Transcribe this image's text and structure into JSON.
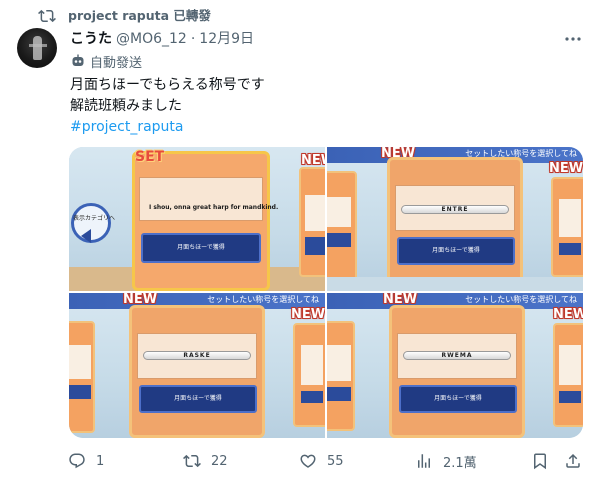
{
  "repost": {
    "label": "project raputa 已轉發"
  },
  "author": {
    "display_name": "こうた",
    "handle": "@MO6_12",
    "separator": "·",
    "date": "12月9日",
    "bot_label": "自動發送"
  },
  "tweet": {
    "lines": [
      "月面ちほーでもらえる称号です",
      "解読班頼みました"
    ],
    "hashtag": "#project_raputa"
  },
  "images": [
    {
      "badge": "SET",
      "badge_right": "NEW",
      "side_label": "表示カテゴリへ",
      "title": "I shou, onna great harp for mandkind.",
      "button": "月面ちほーで獲得"
    },
    {
      "badge": "NEW",
      "badge_right": "NEW",
      "header": "セットしたい称号を選択してね",
      "title": "ENTRE",
      "button": "月面ちほーで獲得"
    },
    {
      "badge": "NEW",
      "badge_right": "NEW",
      "header": "セットしたい称号を選択してね",
      "title": "RASKE",
      "button": "月面ちほーで獲得"
    },
    {
      "badge": "NEW",
      "badge_right": "NEW",
      "header": "セットしたい称号を選択してね",
      "title": "RWEMA",
      "button": "月面ちほーで獲得"
    }
  ],
  "actions": {
    "replies": "1",
    "reposts": "22",
    "likes": "55",
    "views": "2.1萬"
  },
  "colors": {
    "link": "#1d9bf0",
    "muted": "#536471",
    "text": "#0f1419"
  }
}
